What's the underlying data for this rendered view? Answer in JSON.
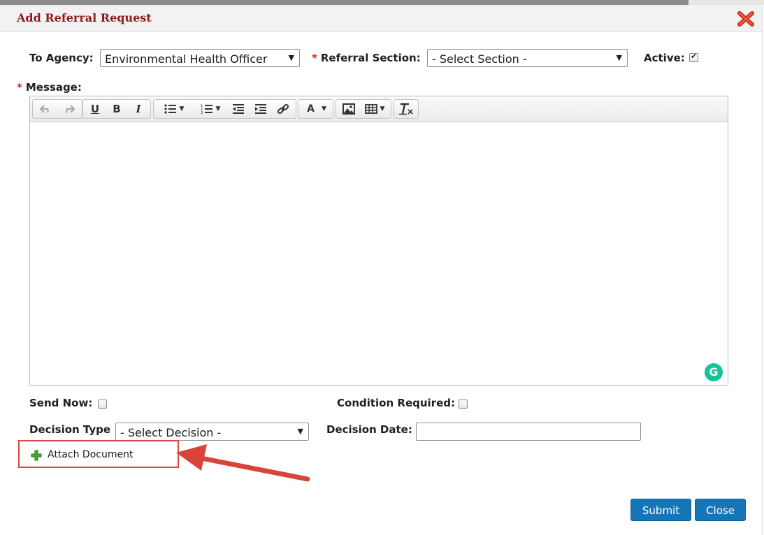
{
  "dialog": {
    "title": "Add Referral Request",
    "accent_color": "#8b1a1a",
    "close_icon": "close-x-icon"
  },
  "form": {
    "to_agency": {
      "label": "To Agency:",
      "value": "Environmental Health Officer"
    },
    "referral_section": {
      "required_mark": "*",
      "label": "Referral Section:",
      "value": "- Select Section -"
    },
    "active": {
      "label": "Active:",
      "checked": true
    },
    "message": {
      "required_mark": "*",
      "label": "Message:"
    },
    "send_now": {
      "label": "Send Now:",
      "checked": false
    },
    "condition_required": {
      "label": "Condition Required:",
      "checked": false
    },
    "decision_type": {
      "label": "Decision Type",
      "value": "- Select Decision -"
    },
    "decision_date": {
      "label": "Decision Date:",
      "value": ""
    },
    "attach_document": {
      "label": "Attach Document",
      "icon": "green-plus-icon"
    }
  },
  "editor": {
    "toolbar_icons": [
      "undo-icon",
      "redo-icon",
      "underline-icon",
      "bold-icon",
      "italic-icon",
      "bullet-list-icon",
      "numbered-list-icon",
      "outdent-icon",
      "indent-icon",
      "link-icon",
      "text-color-icon",
      "image-icon",
      "table-icon",
      "clear-format-icon"
    ],
    "underline_glyph": "U",
    "bold_glyph": "B",
    "italic_glyph": "I",
    "text_color_glyph": "A",
    "grammarly_glyph": "G"
  },
  "buttons": {
    "submit": "Submit",
    "close": "Close"
  },
  "colors": {
    "primary_button": "#1577b8",
    "required": "#d0211c",
    "highlight": "#e0463e",
    "grammarly": "#15c39a"
  }
}
